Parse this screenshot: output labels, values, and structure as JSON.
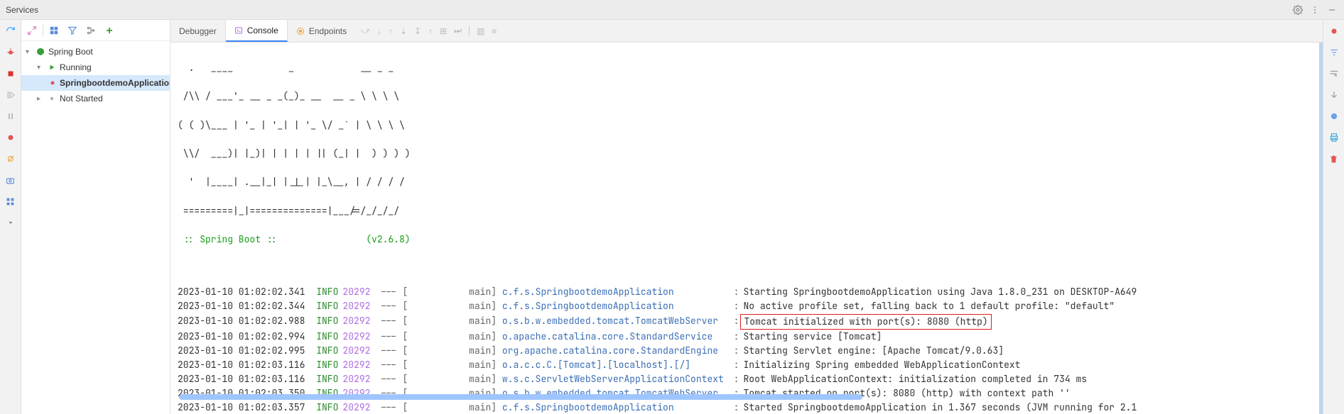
{
  "panel": {
    "title": "Services"
  },
  "tree": {
    "root": {
      "label": "Spring Boot"
    },
    "running": {
      "label": "Running"
    },
    "app": {
      "label": "SpringbootdemoApplication"
    },
    "notstarted": {
      "label": "Not Started"
    }
  },
  "tabs": {
    "debugger": "Debugger",
    "console": "Console",
    "endpoints": "Endpoints"
  },
  "banner": {
    "l1": "  .   ____          _            __ _ _",
    "l2": " /\\\\ / ___'_ __ _ _(_)_ __  __ _ \\ \\ \\ \\",
    "l3": "( ( )\\___ | '_ | '_| | '_ \\/ _` | \\ \\ \\ \\",
    "l4": " \\\\/  ___)| |_)| | | | | || (_| |  ) ) ) )",
    "l5": "  '  |____| .__|_| |_|_| |_\\__, | / / / /",
    "l6": " =========|_|==============|___/=/_/_/_/",
    "tag": " :: Spring Boot ::                (v2.6.8)"
  },
  "logs": [
    {
      "ts": "2023-01-10 01:02:02.341",
      "level": "INFO",
      "pid": "20292",
      "thread": "main",
      "cls": "c.f.s.SpringbootdemoApplication",
      "msg": "Starting SpringbootdemoApplication using Java 1.8.0_231 on DESKTOP-A649",
      "hl": false
    },
    {
      "ts": "2023-01-10 01:02:02.344",
      "level": "INFO",
      "pid": "20292",
      "thread": "main",
      "cls": "c.f.s.SpringbootdemoApplication",
      "msg": "No active profile set, falling back to 1 default profile: \"default\"",
      "hl": false
    },
    {
      "ts": "2023-01-10 01:02:02.988",
      "level": "INFO",
      "pid": "20292",
      "thread": "main",
      "cls": "o.s.b.w.embedded.tomcat.TomcatWebServer",
      "msg": "Tomcat initialized with port(s): 8080 (http)",
      "hl": true
    },
    {
      "ts": "2023-01-10 01:02:02.994",
      "level": "INFO",
      "pid": "20292",
      "thread": "main",
      "cls": "o.apache.catalina.core.StandardService",
      "msg": "Starting service [Tomcat]",
      "hl": false
    },
    {
      "ts": "2023-01-10 01:02:02.995",
      "level": "INFO",
      "pid": "20292",
      "thread": "main",
      "cls": "org.apache.catalina.core.StandardEngine",
      "msg": "Starting Servlet engine: [Apache Tomcat/9.0.63]",
      "hl": false
    },
    {
      "ts": "2023-01-10 01:02:03.116",
      "level": "INFO",
      "pid": "20292",
      "thread": "main",
      "cls": "o.a.c.c.C.[Tomcat].[localhost].[/]",
      "msg": "Initializing Spring embedded WebApplicationContext",
      "hl": false
    },
    {
      "ts": "2023-01-10 01:02:03.116",
      "level": "INFO",
      "pid": "20292",
      "thread": "main",
      "cls": "w.s.c.ServletWebServerApplicationContext",
      "msg": "Root WebApplicationContext: initialization completed in 734 ms",
      "hl": false
    },
    {
      "ts": "2023-01-10 01:02:03.350",
      "level": "INFO",
      "pid": "20292",
      "thread": "main",
      "cls": "o.s.b.w.embedded.tomcat.TomcatWebServer",
      "msg": "Tomcat started on port(s): 8080 (http) with context path ''",
      "hl": false
    },
    {
      "ts": "2023-01-10 01:02:03.357",
      "level": "INFO",
      "pid": "20292",
      "thread": "main",
      "cls": "c.f.s.SpringbootdemoApplication",
      "msg": "Started SpringbootdemoApplication in 1.367 seconds (JVM running for 2.1",
      "hl": false
    }
  ],
  "cls_width": 41
}
